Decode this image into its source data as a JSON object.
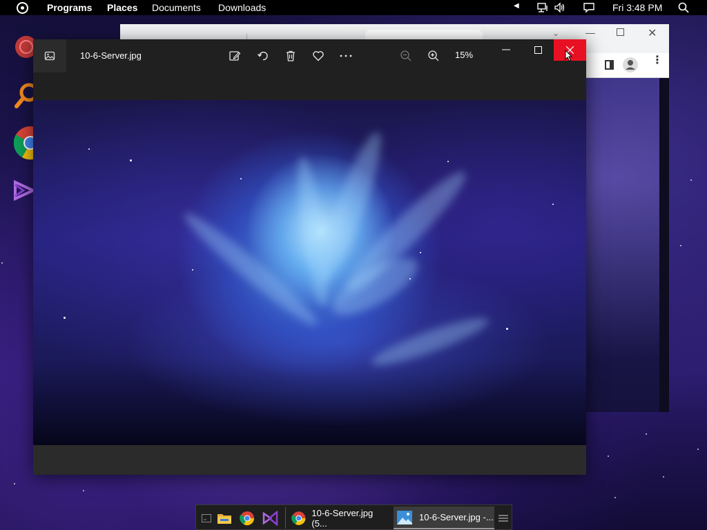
{
  "topbar": {
    "menu": [
      "Programs",
      "Places",
      "Documents",
      "Downloads"
    ],
    "clock": "Fri  3:48 PM"
  },
  "photos": {
    "filename": "10-6-Server.jpg",
    "zoom": "15%"
  },
  "taskbar": {
    "items": [
      {
        "label": "10-6-Server.jpg (5..."
      },
      {
        "label": "10-6-Server.jpg -..."
      }
    ]
  },
  "colors": {
    "close_button": "#e81123",
    "window_bg": "#202020",
    "topbar_bg": "#000000"
  },
  "icons": [
    "system-menu-icon",
    "network-icon",
    "volume-icon",
    "notification-icon",
    "search-icon",
    "image-icon",
    "edit-icon",
    "rotate-icon",
    "trash-icon",
    "heart-icon",
    "more-icon",
    "zoom-out-icon",
    "zoom-in-icon",
    "minimize-icon",
    "maximize-icon",
    "close-icon",
    "file-manager-icon",
    "chrome-icon",
    "visual-studio-icon",
    "photos-icon",
    "menu-icon"
  ]
}
